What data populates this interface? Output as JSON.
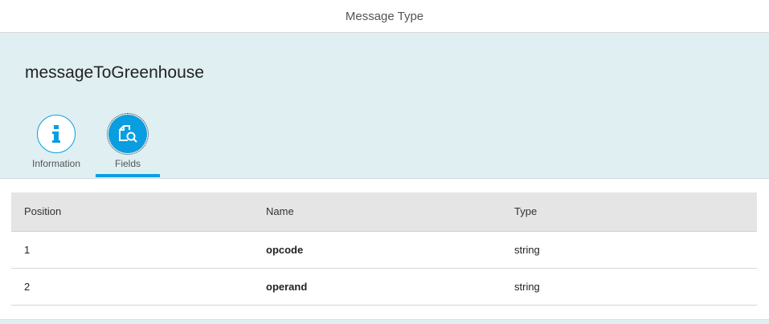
{
  "header": {
    "title": "Message Type"
  },
  "object": {
    "title": "messageToGreenhouse"
  },
  "tabs": [
    {
      "label": "Information",
      "icon": "info-icon"
    },
    {
      "label": "Fields",
      "icon": "document-search-icon",
      "selected": true
    }
  ],
  "colors": {
    "accent": "#0a9ee0",
    "header_bg": "#dfeff2"
  },
  "table": {
    "columns": [
      "Position",
      "Name",
      "Type"
    ],
    "rows": [
      {
        "position": "1",
        "name": "opcode",
        "type": "string"
      },
      {
        "position": "2",
        "name": "operand",
        "type": "string"
      }
    ]
  }
}
